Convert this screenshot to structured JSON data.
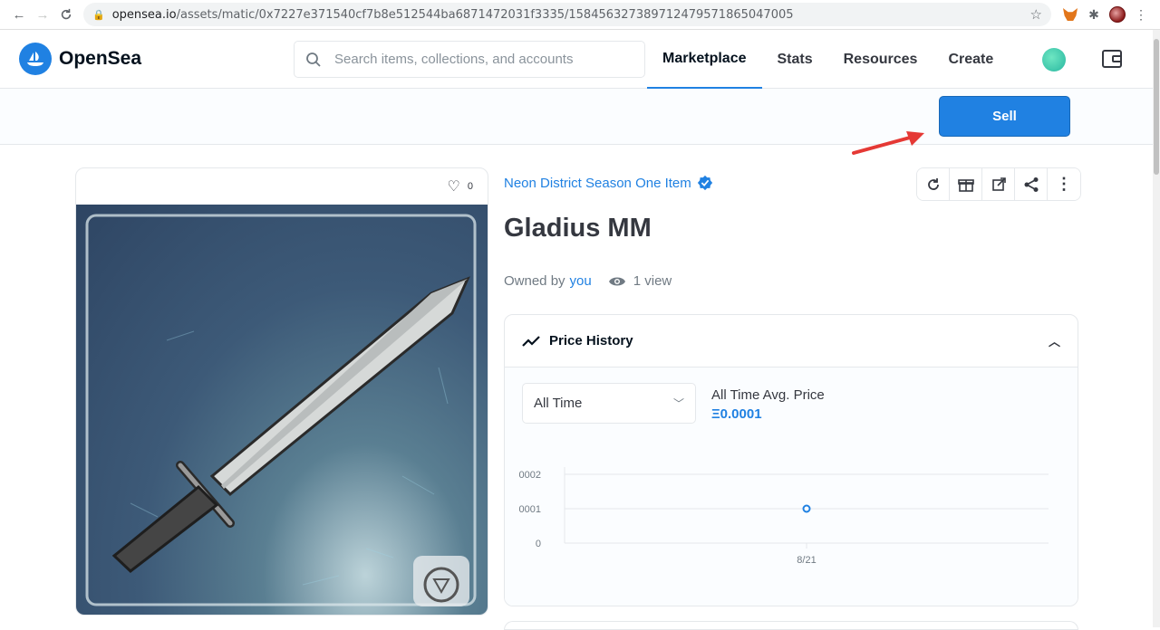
{
  "browser": {
    "url_host": "opensea.io",
    "url_path": "/assets/matic/0x7227e371540cf7b8e512544ba6871472031f3335/15845632738971247957186504700 5"
  },
  "nav": {
    "brand": "OpenSea",
    "search_placeholder": "Search items, collections, and accounts",
    "menu": [
      "Marketplace",
      "Stats",
      "Resources",
      "Create"
    ],
    "active_menu": "Marketplace"
  },
  "sell_label": "Sell",
  "item": {
    "likes": "0",
    "collection": "Neon District Season One Item",
    "name": "Gladius MM",
    "owned_by": "Owned by",
    "owner": "you",
    "views": "1 view"
  },
  "price_history": {
    "title": "Price History",
    "range": "All Time",
    "avg_label": "All Time Avg. Price",
    "avg_value": "Ξ0.0001"
  },
  "chart_data": {
    "type": "scatter",
    "x": [
      "8/21"
    ],
    "values": [
      0.0001
    ],
    "ytick_labels": [
      "0002",
      "0001",
      "0"
    ],
    "xlabel": "",
    "ylabel": "",
    "ylim": [
      0,
      0.0002
    ]
  },
  "colors": {
    "accent": "#2081e2",
    "text": "#353840"
  }
}
